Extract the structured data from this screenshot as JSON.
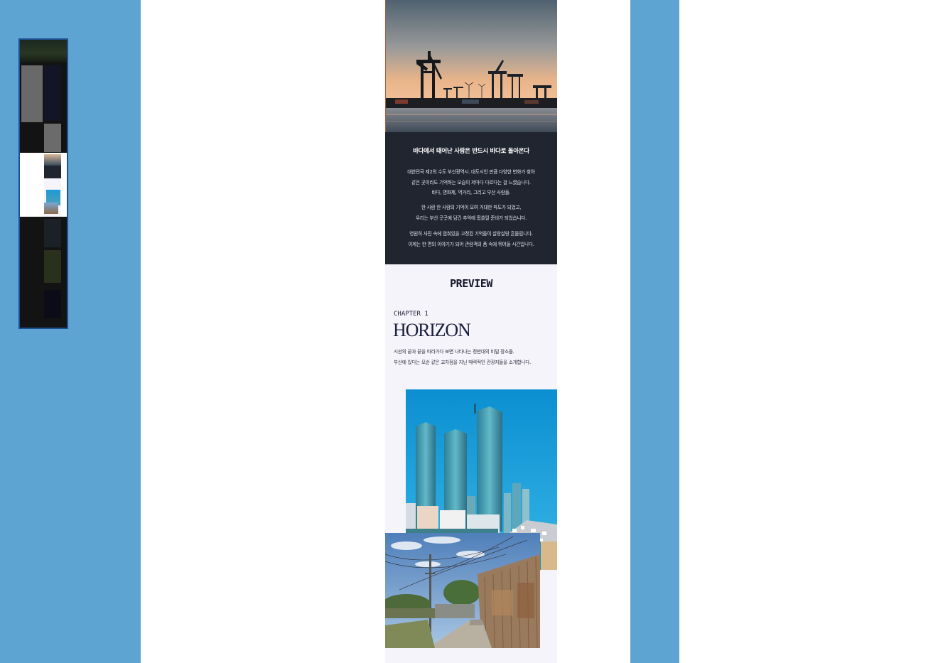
{
  "colors": {
    "background": "#5ea4d3",
    "panel": "#ffffff",
    "story_bg": "#212530",
    "preview_bg": "#f6f4fb",
    "minimap_border": "#1d4f93"
  },
  "minimap": {
    "icon": "page-thumbnail"
  },
  "hero": {
    "icon": "harbor-crane-sunset-photo"
  },
  "story": {
    "title": "바다에서 태어난 사람은 반드시 바다로 돌아온다",
    "para1": [
      "대한민국 제2의 수도 부산광역시. 대도시인 만큼 다양한 변화가 찾아",
      "같은 곳이라도 기억하는 모습이 저마다 다르다는 걸 느꼈습니다.",
      "바다, 영화제, 먹거리, 그리고 부산 사람들."
    ],
    "para2": [
      "한 사람 한 사람의 기억이 모여 거대한 파도가 되었고,",
      "우리는 부산 곳곳에 담긴 추억에 휩쓸릴 준비가 되었습니다."
    ],
    "para3": [
      "영원히 사진 속에 멈춰있을 고정된 기억들이 살랑살랑 흔들립니다.",
      "이제는 한 편의 이야기가 되어 관람객의 품 속에 뛰어들 시간입니다."
    ]
  },
  "preview": {
    "title": "PREVIEW",
    "chapter_label": "CHAPTER 1",
    "chapter_name": "HORIZON",
    "desc": [
      "시선의 끝과 끝을 따라가다 보면 나타나는 정반대의 비밀 장소들.",
      "부산에 있다는 모순 같은 교차점을 지닌 매력적인 관광지들을 소개합니다."
    ],
    "photo1_icon": "city-skyline-photo",
    "photo2_icon": "alley-village-photo"
  }
}
